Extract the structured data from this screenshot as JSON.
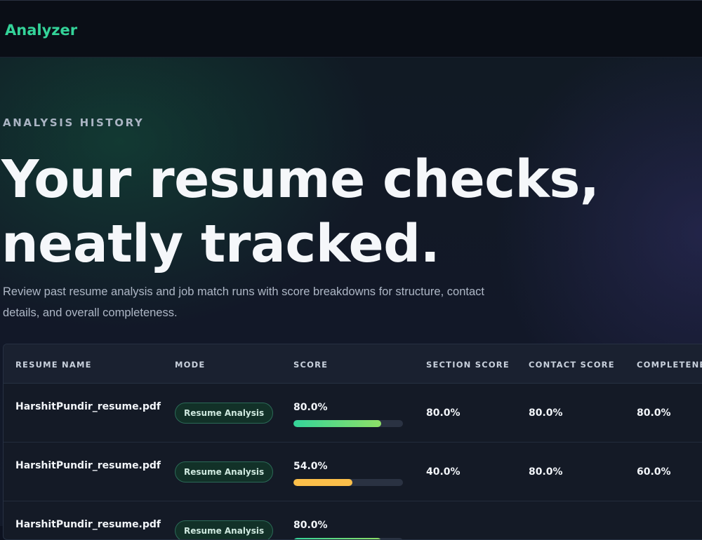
{
  "app": {
    "brand": "Analyzer"
  },
  "hero": {
    "eyebrow": "ANALYSIS HISTORY",
    "headline_line1": "Your resume checks,",
    "headline_line2": "neatly tracked.",
    "description": "Review past resume analysis and job match runs with score breakdowns for structure, contact details, and overall completeness."
  },
  "table": {
    "columns": [
      "RESUME NAME",
      "MODE",
      "SCORE",
      "SECTION SCORE",
      "CONTACT SCORE",
      "COMPLETENE"
    ],
    "rows": [
      {
        "name": "HarshitPundir_resume.pdf",
        "mode": "Resume Analysis",
        "score": "80.0%",
        "score_fraction": 0.8,
        "section": "80.0%",
        "contact": "80.0%",
        "completeness": "80.0%"
      },
      {
        "name": "HarshitPundir_resume.pdf",
        "mode": "Resume Analysis",
        "score": "54.0%",
        "score_fraction": 0.54,
        "section": "40.0%",
        "contact": "80.0%",
        "completeness": "60.0%"
      },
      {
        "name": "HarshitPundir_resume.pdf",
        "mode": "Resume Analysis",
        "score": "80.0%",
        "score_fraction": 0.8,
        "section": "",
        "contact": "",
        "completeness": ""
      }
    ]
  },
  "colors": {
    "accent": "#34d399",
    "bar_high": "#34d399",
    "bar_high_end": "#8ee067",
    "bar_mid": "#fbbf4a"
  }
}
